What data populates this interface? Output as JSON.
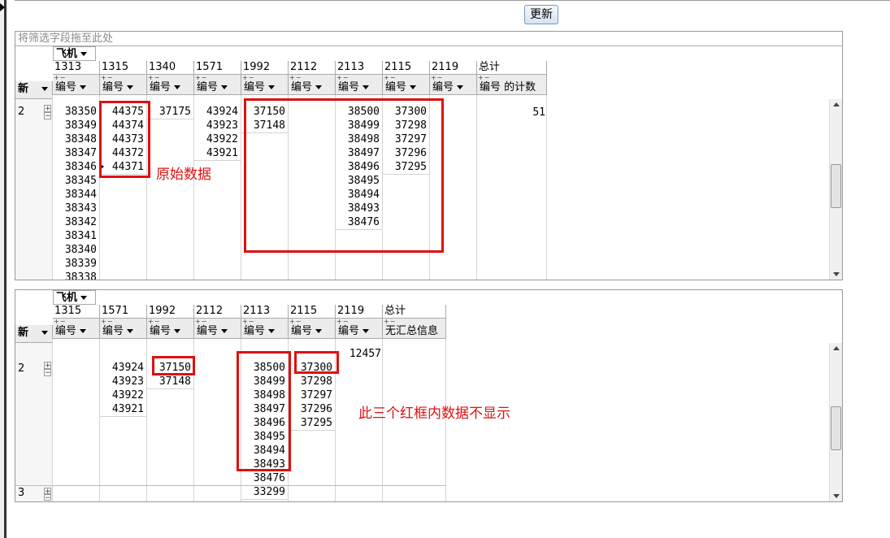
{
  "toolbar": {
    "update_label": "更新"
  },
  "pivot1": {
    "filter_placeholder": "将筛选字段拖至此处",
    "column_field": "飞机",
    "row_field": "新",
    "data_field": "编号",
    "columns": [
      "1313",
      "1315",
      "1340",
      "1571",
      "1992",
      "2112",
      "2113",
      "2115",
      "2119"
    ],
    "total_label": "总计",
    "total_field": "编号 的计数",
    "row": {
      "label": "2",
      "values": {
        "1313": [
          "38350",
          "38349",
          "38348",
          "38347",
          "38346",
          "38345",
          "38344",
          "38343",
          "38342",
          "38341",
          "38340",
          "38339",
          "38338"
        ],
        "1315": [
          "44375",
          "44374",
          "44373",
          "44372",
          "44371"
        ],
        "1340": [
          "37175"
        ],
        "1571": [
          "43924",
          "43923",
          "43922",
          "43921"
        ],
        "1992": [
          "37150",
          "37148"
        ],
        "2112": [],
        "2113": [
          "38500",
          "38499",
          "38498",
          "38497",
          "38496",
          "38495",
          "38494",
          "38493",
          "38476"
        ],
        "2115": [
          "37300",
          "37298",
          "37297",
          "37296",
          "37295"
        ],
        "2119": []
      },
      "total": "51"
    },
    "annotation": "原始数据"
  },
  "pivot2": {
    "column_field": "飞机",
    "row_field": "新",
    "data_field": "编号",
    "columns": [
      "1315",
      "1571",
      "1992",
      "2112",
      "2113",
      "2115",
      "2119"
    ],
    "total_label": "总计",
    "total_field": "无汇总信息",
    "prev_value": "12457",
    "rows": [
      {
        "label": "2",
        "values": {
          "1315": [],
          "1571": [
            "43924",
            "43923",
            "43922",
            "43921"
          ],
          "1992": [
            "37150",
            "37148"
          ],
          "2112": [],
          "2113": [
            "38500",
            "38499",
            "38498",
            "38497",
            "38496",
            "38495",
            "38494",
            "38493",
            "38476",
            "33299"
          ],
          "2115": [
            "37300",
            "37298",
            "37297",
            "37296",
            "37295"
          ],
          "2119": []
        }
      },
      {
        "label": "3"
      }
    ],
    "annotation": "此三个红框内数据不显示"
  },
  "colors": {
    "annotation": "#e01010",
    "header_bg": "#ececec",
    "border": "#999999"
  }
}
